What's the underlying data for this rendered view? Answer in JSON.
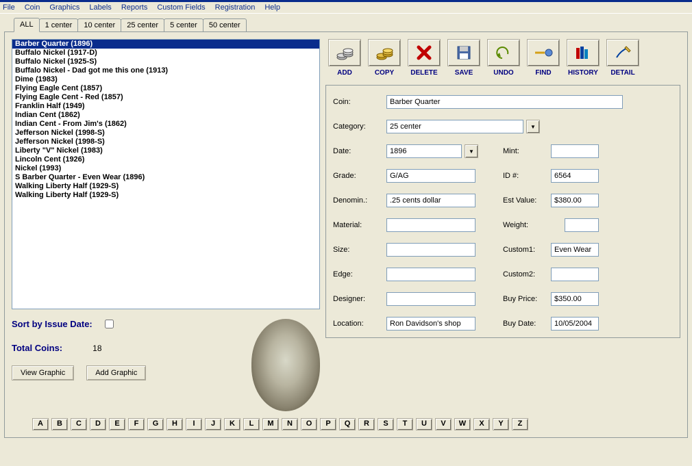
{
  "menubar": [
    "File",
    "Coin",
    "Graphics",
    "Labels",
    "Reports",
    "Custom Fields",
    "Registration",
    "Help"
  ],
  "tabs": [
    {
      "label": "ALL",
      "active": true
    },
    {
      "label": "1 center",
      "active": false
    },
    {
      "label": "10 center",
      "active": false
    },
    {
      "label": "25 center",
      "active": false
    },
    {
      "label": "5 center",
      "active": false
    },
    {
      "label": "50 center",
      "active": false
    }
  ],
  "list": [
    "Barber Quarter (1896)",
    "Buffalo Nickel (1917-D)",
    "Buffalo Nickel (1925-S)",
    "Buffalo Nickel - Dad got me this one (1913)",
    "Dime (1983)",
    "Flying Eagle Cent (1857)",
    "Flying Eagle Cent - Red (1857)",
    "Franklin Half (1949)",
    "Indian Cent (1862)",
    "Indian Cent - From Jim's (1862)",
    "Jefferson Nickel (1998-S)",
    "Jefferson Nickel (1998-S)",
    "Liberty \"V\" Nickel (1983)",
    "Lincoln Cent (1926)",
    "Nickel (1993)",
    "S Barber Quarter - Even Wear (1896)",
    "Walking Liberty Half (1929-S)",
    "Walking Liberty Half (1929-S)"
  ],
  "list_selected": 0,
  "sort_label": "Sort by Issue Date:",
  "total_label": "Total Coins:",
  "total_value": "18",
  "view_graphic_btn": "View Graphic",
  "add_graphic_btn": "Add Graphic",
  "toolbar": [
    {
      "label": "ADD",
      "name": "add-button",
      "icon": "coins-silver"
    },
    {
      "label": "COPY",
      "name": "copy-button",
      "icon": "coins-gold"
    },
    {
      "label": "DELETE",
      "name": "delete-button",
      "icon": "x-red"
    },
    {
      "label": "SAVE",
      "name": "save-button",
      "icon": "disk"
    },
    {
      "label": "UNDO",
      "name": "undo-button",
      "icon": "undo"
    },
    {
      "label": "FIND",
      "name": "find-button",
      "icon": "find"
    },
    {
      "label": "HISTORY",
      "name": "history-button",
      "icon": "books"
    },
    {
      "label": "DETAIL",
      "name": "detail-button",
      "icon": "pencil"
    }
  ],
  "form": {
    "coin_label": "Coin:",
    "coin": "Barber Quarter",
    "category_label": "Category:",
    "category": "25 center",
    "date_label": "Date:",
    "date": "1896",
    "mint_label": "Mint:",
    "mint": "",
    "grade_label": "Grade:",
    "grade": "G/AG",
    "id_label": "ID #:",
    "id": "6564",
    "denom_label": "Denomin.:",
    "denom": ".25 cents dollar",
    "est_label": "Est Value:",
    "est": "$380.00",
    "material_label": "Material:",
    "material": "",
    "weight_label": "Weight:",
    "weight": "",
    "size_label": "Size:",
    "size": "",
    "custom1_label": "Custom1:",
    "custom1": "Even Wear",
    "edge_label": "Edge:",
    "edge": "",
    "custom2_label": "Custom2:",
    "custom2": "",
    "designer_label": "Designer:",
    "designer": "",
    "buyprice_label": "Buy Price:",
    "buyprice": "$350.00",
    "location_label": "Location:",
    "location": "Ron Davidson's shop",
    "buydate_label": "Buy Date:",
    "buydate": "10/05/2004"
  },
  "alpha": [
    "A",
    "B",
    "C",
    "D",
    "E",
    "F",
    "G",
    "H",
    "I",
    "J",
    "K",
    "L",
    "M",
    "N",
    "O",
    "P",
    "Q",
    "R",
    "S",
    "T",
    "U",
    "V",
    "W",
    "X",
    "Y",
    "Z"
  ]
}
